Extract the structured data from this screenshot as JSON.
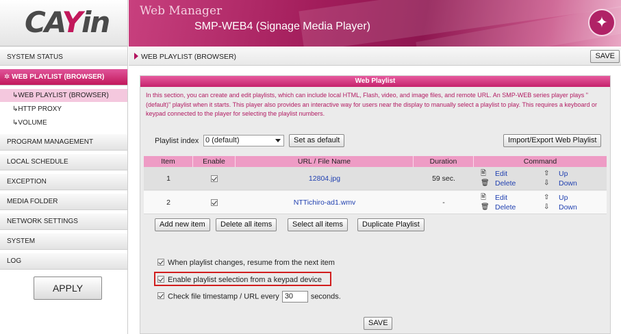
{
  "header": {
    "logo_pre": "CA",
    "logo_accent": "Y",
    "logo_post": "in",
    "app_name": "Web Manager",
    "subtitle": "SMP-WEB4 (Signage Media Player)"
  },
  "sidebar": {
    "items": [
      {
        "label": "SYSTEM STATUS"
      },
      {
        "label": "WEB PLAYLIST (BROWSER)"
      },
      {
        "label": "PROGRAM MANAGEMENT"
      },
      {
        "label": "LOCAL SCHEDULE"
      },
      {
        "label": "EXCEPTION"
      },
      {
        "label": "MEDIA FOLDER"
      },
      {
        "label": "NETWORK SETTINGS"
      },
      {
        "label": "SYSTEM"
      },
      {
        "label": "LOG"
      }
    ],
    "sub_items": [
      {
        "label": "WEB PLAYLIST (BROWSER)"
      },
      {
        "label": "HTTP PROXY"
      },
      {
        "label": "VOLUME"
      }
    ],
    "apply_label": "APPLY"
  },
  "main": {
    "breadcrumb": "WEB PLAYLIST (BROWSER)",
    "save_top": "SAVE",
    "panel_title": "Web Playlist",
    "description": "In this section, you can create and edit playlists, which can include local HTML, Flash, video, and image files, and remote URL. An SMP-WEB series player plays \"(default)\" playlist when it starts. This player also provides an interactive way for users near the display to manually select a playlist to play. This requires a keyboard or keypad connected to the player for selecting the playlist numbers.",
    "playlist_index_label": "Playlist index",
    "playlist_index_value": "0 (default)",
    "set_default_label": "Set as default",
    "import_export_label": "Import/Export Web Playlist",
    "table": {
      "headers": [
        "Item",
        "Enable",
        "URL / File Name",
        "Duration",
        "Command"
      ],
      "rows": [
        {
          "item": "1",
          "enabled": true,
          "file": "12804.jpg",
          "duration": "59 sec."
        },
        {
          "item": "2",
          "enabled": true,
          "file": "NTTichiro-ad1.wmv",
          "duration": "-"
        }
      ],
      "cmd_edit": "Edit",
      "cmd_delete": "Delete",
      "cmd_up": "Up",
      "cmd_down": "Down"
    },
    "buttons": {
      "add_new": "Add new item",
      "delete_all": "Delete all items",
      "select_all": "Select all items",
      "duplicate": "Duplicate Playlist"
    },
    "options": {
      "resume_label": "When playlist changes, resume from the next item",
      "keypad_label": "Enable playlist selection from a keypad device",
      "timestamp_pre": "Check file timestamp / URL every",
      "timestamp_value": "30",
      "timestamp_post": "seconds."
    },
    "save_bottom": "SAVE"
  },
  "colors": {
    "brand": "#c2185b",
    "highlight": "#d11d1d",
    "link": "#2040b0"
  }
}
